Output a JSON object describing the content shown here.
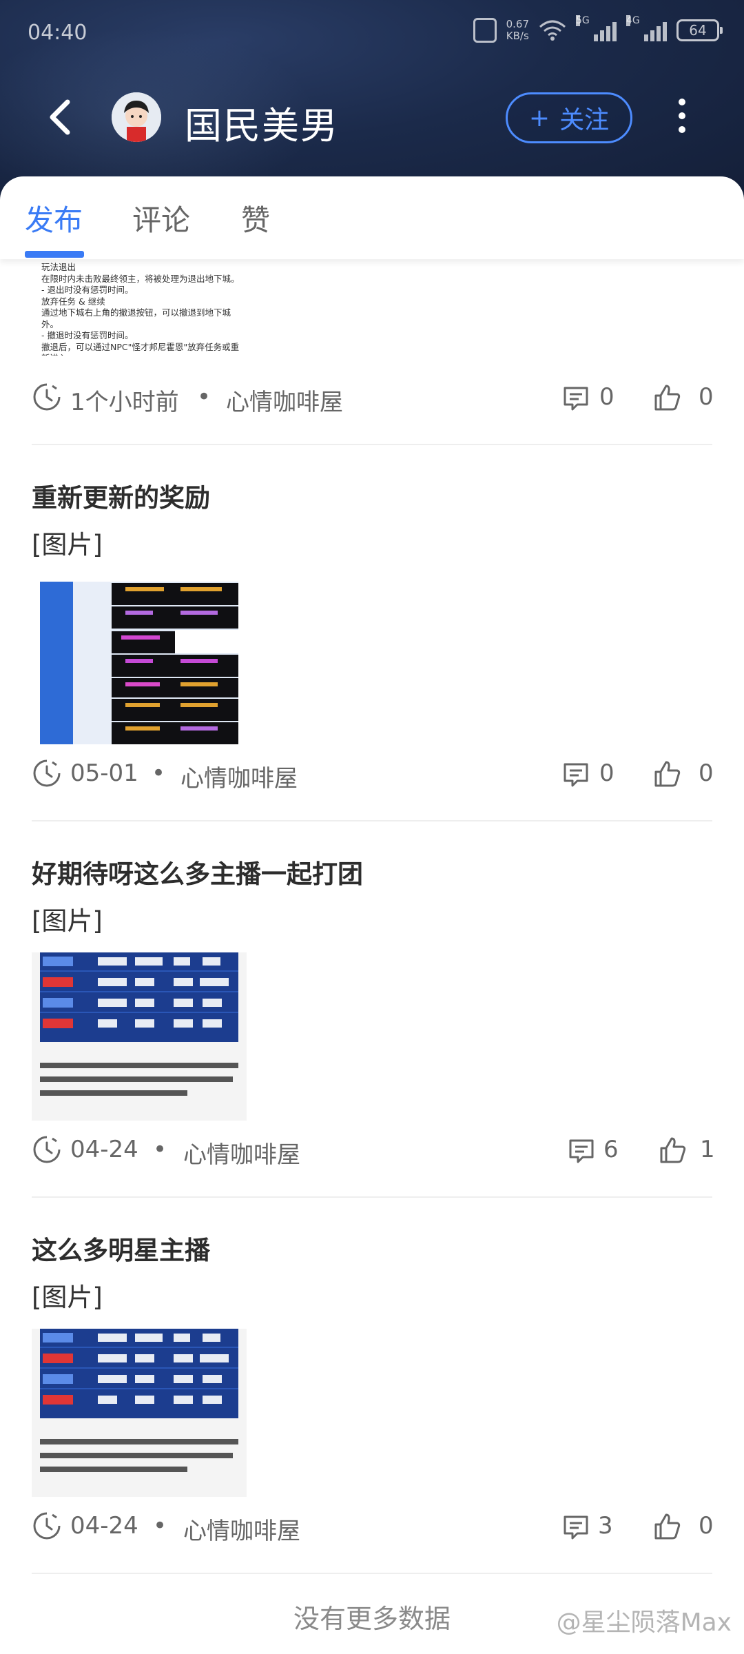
{
  "status_bar": {
    "time": "04:40",
    "network_speed": "0.67",
    "network_unit": "KB/s",
    "sim1": "5G",
    "sim2": "4G",
    "battery": "64"
  },
  "header": {
    "title": "国民美男",
    "follow_label": "关注",
    "follow_plus": "+"
  },
  "tabs": [
    {
      "label": "发布",
      "active": true
    },
    {
      "label": "评论",
      "active": false
    },
    {
      "label": "赞",
      "active": false
    }
  ],
  "partial_post": {
    "text_lines": [
      "玩法退出",
      "在限时内未击败最终领主，将被处理为退出地下城。",
      "- 退出时没有惩罚时间。",
      "放弃任务 & 继续",
      "通过地下城右上角的撤退按钮，可以撤退到地下城外。",
      "- 撤退时没有惩罚时间。",
      "撤退后，可以通过NPC\"怪才邦尼霍恩\"放弃任务或重新进入。"
    ],
    "time": "1个小时前",
    "category": "心情咖啡屋",
    "comments": "0",
    "likes": "0"
  },
  "posts": [
    {
      "title": "重新更新的奖励",
      "subtitle": "[图片]",
      "time": "05-01",
      "category": "心情咖啡屋",
      "comments": "0",
      "likes": "0"
    },
    {
      "title": "好期待呀这么多主播一起打团",
      "subtitle": "[图片]",
      "time": "04-24",
      "category": "心情咖啡屋",
      "comments": "6",
      "likes": "1"
    },
    {
      "title": "这么多明星主播",
      "subtitle": "[图片]",
      "time": "04-24",
      "category": "心情咖啡屋",
      "comments": "3",
      "likes": "0"
    }
  ],
  "footer": {
    "no_more": "没有更多数据",
    "watermark": "@星尘陨落Max"
  },
  "colors": {
    "accent": "#3a7bf5",
    "header_bg": "#1b2a4a"
  }
}
